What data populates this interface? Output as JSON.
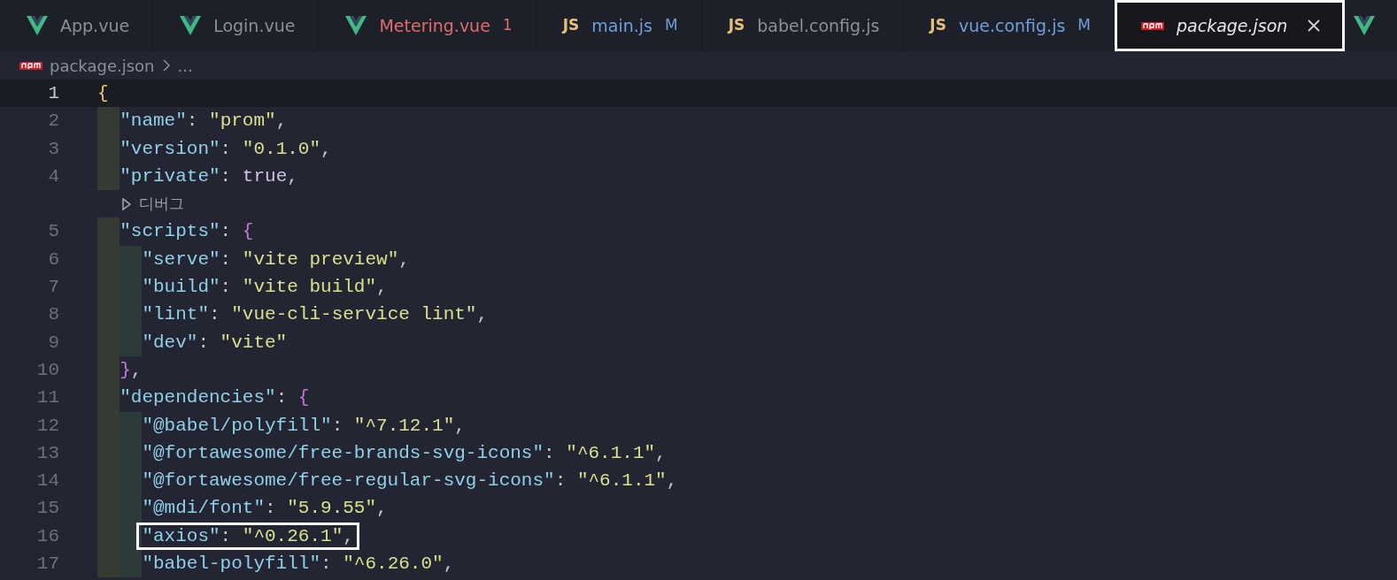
{
  "tabs": [
    {
      "kind": "vue",
      "label": "App.vue",
      "color": "#8a8f98",
      "selected": false,
      "outlined": false
    },
    {
      "kind": "vue",
      "label": "Login.vue",
      "color": "#8a8f98",
      "selected": false,
      "outlined": false
    },
    {
      "kind": "vue",
      "label": "Metering.vue",
      "color": "#e06c6c",
      "badge": "1",
      "selected": false,
      "outlined": false
    },
    {
      "kind": "js",
      "icon_text": "JS",
      "label": "main.js",
      "color": "#6f9fd8",
      "badge": "M",
      "selected": false,
      "outlined": false
    },
    {
      "kind": "js",
      "icon_text": "JS",
      "label": "babel.config.js",
      "color": "#8a8f98",
      "selected": false,
      "outlined": false
    },
    {
      "kind": "js",
      "icon_text": "JS",
      "label": "vue.config.js",
      "color": "#6f9fd8",
      "badge": "M",
      "selected": false,
      "outlined": false
    },
    {
      "kind": "json",
      "label": "package.json",
      "color": "#e6e6e6",
      "selected": true,
      "outlined": true
    },
    {
      "kind": "vue",
      "selected": false,
      "outlined": false
    }
  ],
  "breadcrumb": {
    "items": [
      "package.json",
      "..."
    ]
  },
  "editor": {
    "lines": [
      {
        "kind": "code",
        "number": "1",
        "current": true,
        "outlined": false,
        "tokens": [
          {
            "kind": "brace",
            "text": "{"
          }
        ],
        "children": [
          {
            "kind": "code",
            "number": "2",
            "current": false,
            "outlined": false,
            "tokens": [
              {
                "kind": "key",
                "text": "\"name\""
              },
              {
                "kind": "punct",
                "text": ": "
              },
              {
                "kind": "string",
                "text": "\"prom\""
              },
              {
                "kind": "punct",
                "text": ","
              }
            ]
          },
          {
            "kind": "code",
            "number": "3",
            "current": false,
            "outlined": false,
            "tokens": [
              {
                "kind": "key",
                "text": "\"version\""
              },
              {
                "kind": "punct",
                "text": ": "
              },
              {
                "kind": "string",
                "text": "\"0.1.0\""
              },
              {
                "kind": "punct",
                "text": ","
              }
            ]
          },
          {
            "kind": "code",
            "number": "4",
            "current": false,
            "outlined": false,
            "tokens": [
              {
                "kind": "key",
                "text": "\"private\""
              },
              {
                "kind": "punct",
                "text": ": "
              },
              {
                "kind": "keyword",
                "text": "true"
              },
              {
                "kind": "punct",
                "text": ","
              }
            ]
          },
          {
            "kind": "codelens",
            "text": "디버그"
          },
          {
            "kind": "code",
            "number": "5",
            "current": false,
            "outlined": false,
            "tokens": [
              {
                "kind": "key",
                "text": "\"scripts\""
              },
              {
                "kind": "punct",
                "text": ": "
              },
              {
                "kind": "brace2",
                "text": "{"
              }
            ],
            "children": [
              {
                "kind": "code",
                "number": "6",
                "current": false,
                "outlined": false,
                "tokens": [
                  {
                    "kind": "key",
                    "text": "\"serve\""
                  },
                  {
                    "kind": "punct",
                    "text": ": "
                  },
                  {
                    "kind": "string",
                    "text": "\"vite preview\""
                  },
                  {
                    "kind": "punct",
                    "text": ","
                  }
                ]
              },
              {
                "kind": "code",
                "number": "7",
                "current": false,
                "outlined": false,
                "tokens": [
                  {
                    "kind": "key",
                    "text": "\"build\""
                  },
                  {
                    "kind": "punct",
                    "text": ": "
                  },
                  {
                    "kind": "string",
                    "text": "\"vite build\""
                  },
                  {
                    "kind": "punct",
                    "text": ","
                  }
                ]
              },
              {
                "kind": "code",
                "number": "8",
                "current": false,
                "outlined": false,
                "tokens": [
                  {
                    "kind": "key",
                    "text": "\"lint\""
                  },
                  {
                    "kind": "punct",
                    "text": ": "
                  },
                  {
                    "kind": "string",
                    "text": "\"vue-cli-service lint\""
                  },
                  {
                    "kind": "punct",
                    "text": ","
                  }
                ]
              },
              {
                "kind": "code",
                "number": "9",
                "current": false,
                "outlined": false,
                "tokens": [
                  {
                    "kind": "key",
                    "text": "\"dev\""
                  },
                  {
                    "kind": "punct",
                    "text": ": "
                  },
                  {
                    "kind": "string",
                    "text": "\"vite\""
                  }
                ]
              }
            ]
          },
          {
            "kind": "code",
            "number": "10",
            "current": false,
            "outlined": false,
            "tokens": [
              {
                "kind": "brace2",
                "text": "}"
              },
              {
                "kind": "punct",
                "text": ","
              }
            ]
          },
          {
            "kind": "code",
            "number": "11",
            "current": false,
            "outlined": false,
            "tokens": [
              {
                "kind": "key",
                "text": "\"dependencies\""
              },
              {
                "kind": "punct",
                "text": ": "
              },
              {
                "kind": "brace2",
                "text": "{"
              }
            ],
            "children": [
              {
                "kind": "code",
                "number": "12",
                "current": false,
                "outlined": false,
                "tokens": [
                  {
                    "kind": "key",
                    "text": "\"@babel/polyfill\""
                  },
                  {
                    "kind": "punct",
                    "text": ": "
                  },
                  {
                    "kind": "string",
                    "text": "\"^7.12.1\""
                  },
                  {
                    "kind": "punct",
                    "text": ","
                  }
                ]
              },
              {
                "kind": "code",
                "number": "13",
                "current": false,
                "outlined": false,
                "tokens": [
                  {
                    "kind": "key",
                    "text": "\"@fortawesome/free-brands-svg-icons\""
                  },
                  {
                    "kind": "punct",
                    "text": ": "
                  },
                  {
                    "kind": "string",
                    "text": "\"^6.1.1\""
                  },
                  {
                    "kind": "punct",
                    "text": ","
                  }
                ]
              },
              {
                "kind": "code",
                "number": "14",
                "current": false,
                "outlined": false,
                "tokens": [
                  {
                    "kind": "key",
                    "text": "\"@fortawesome/free-regular-svg-icons\""
                  },
                  {
                    "kind": "punct",
                    "text": ": "
                  },
                  {
                    "kind": "string",
                    "text": "\"^6.1.1\""
                  },
                  {
                    "kind": "punct",
                    "text": ","
                  }
                ]
              },
              {
                "kind": "code",
                "number": "15",
                "current": false,
                "outlined": false,
                "tokens": [
                  {
                    "kind": "key",
                    "text": "\"@mdi/font\""
                  },
                  {
                    "kind": "punct",
                    "text": ": "
                  },
                  {
                    "kind": "string",
                    "text": "\"5.9.55\""
                  },
                  {
                    "kind": "punct",
                    "text": ","
                  }
                ]
              },
              {
                "kind": "code",
                "number": "16",
                "current": false,
                "outlined": true,
                "tokens": [
                  {
                    "kind": "key",
                    "text": "\"axios\""
                  },
                  {
                    "kind": "punct",
                    "text": ": "
                  },
                  {
                    "kind": "string",
                    "text": "\"^0.26.1\""
                  },
                  {
                    "kind": "punct",
                    "text": ","
                  }
                ]
              },
              {
                "kind": "code",
                "number": "17",
                "current": false,
                "outlined": false,
                "tokens": [
                  {
                    "kind": "key",
                    "text": "\"babel-polyfill\""
                  },
                  {
                    "kind": "punct",
                    "text": ": "
                  },
                  {
                    "kind": "string",
                    "text": "\"^6.26.0\""
                  },
                  {
                    "kind": "punct",
                    "text": ","
                  }
                ]
              }
            ]
          }
        ]
      }
    ]
  }
}
